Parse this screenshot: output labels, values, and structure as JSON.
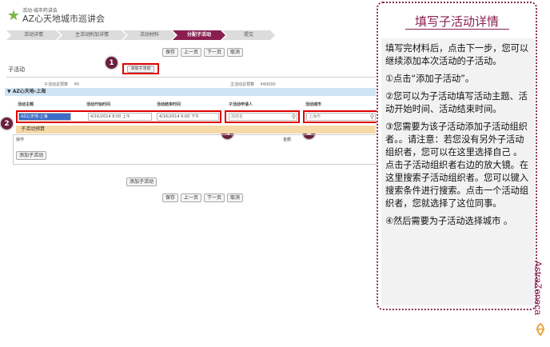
{
  "header": {
    "logo_sub": "活动·城市药讲会",
    "logo_main": "AZ心天地城市巡讲会"
  },
  "steps": [
    {
      "label": "活动详情",
      "active": false
    },
    {
      "label": "主活动附加详情",
      "active": false
    },
    {
      "label": "活动材料",
      "active": false
    },
    {
      "label": "分配子活动",
      "active": true
    },
    {
      "label": "提交",
      "active": false
    }
  ],
  "toolbar": {
    "save": "保存",
    "prev": "上一页",
    "next": "下一页",
    "cancel": "取消"
  },
  "section": {
    "title": "子活动",
    "add_button": "添加子活动"
  },
  "budget": {
    "sub_label": "子活动总预算",
    "sub_value": "¥0",
    "main_label": "主活动总预算",
    "main_value": "¥40000"
  },
  "band": {
    "label": "▼ AZ心天地-上海"
  },
  "columns": {
    "name": "活动主题",
    "start": "活动开始时间",
    "end": "活动结束时间",
    "organizer": "子活动申请人",
    "city": "活动城市"
  },
  "row": {
    "name": "AZ心天地-上海",
    "start": "4/16/2014 8:00 上午",
    "end": "4/16/2014 6:00 下午",
    "organizer_placeholder": "加姓名",
    "city_placeholder": "上海市"
  },
  "sub_budget": {
    "title": "子活动预算",
    "col_action": "操作",
    "col_amount": "金额",
    "add_button": "添加子活动"
  },
  "bottom": {
    "add_button": "添加子活动"
  },
  "badges": [
    "1",
    "2",
    "3",
    "4"
  ],
  "panel": {
    "title": "填写子活动详情",
    "paragraphs": [
      "填写完材料后，点击下一步，您可以继续添加本次活动的子活动。",
      "①点击“添加子活动”。",
      "②您可以为子活动填写活动主题、活动开始时间、活动结束时间。",
      "③您需要为该子活动添加子活动组织者。。请注意：若您没有另外子活动组织者，您可以在这里选择自己 。点击子活动组织者右边的放大镜。在这里搜索子活动组织者。您可以键入搜索条件进行搜索。点击一个活动组织者，您就选择了这位同事。",
      "④然后需要为子活动选择城市 。"
    ]
  },
  "brand": {
    "name": "AstraZeneca"
  },
  "colors": {
    "accent": "#8a1e4f",
    "highlight": "#e00000",
    "band": "#cfe4f5",
    "subhead": "#f6d9a8"
  }
}
